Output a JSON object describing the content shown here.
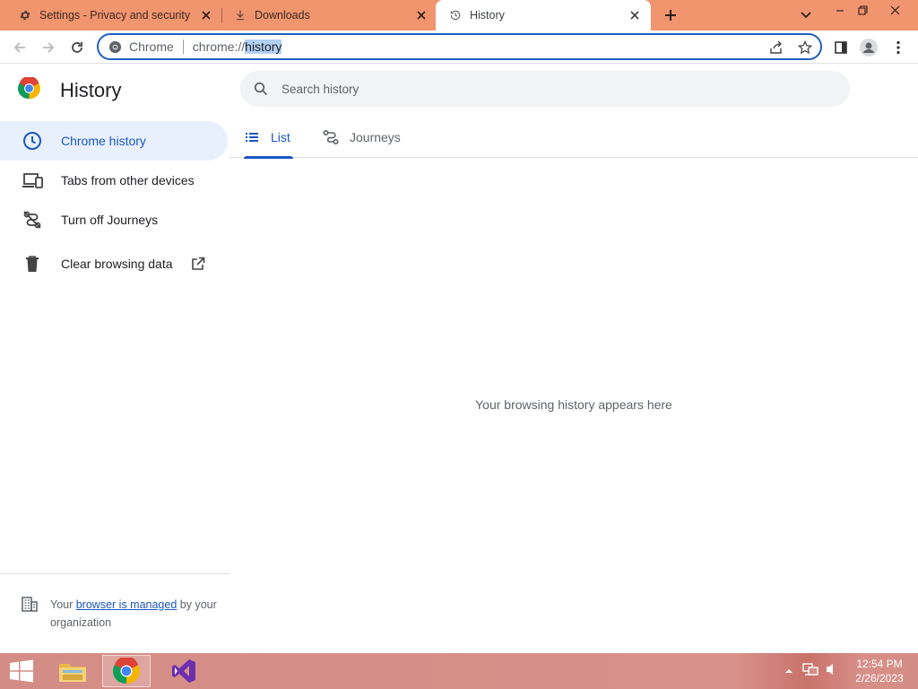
{
  "tabs": [
    {
      "label": "Settings - Privacy and security",
      "icon": "gear-icon"
    },
    {
      "label": "Downloads",
      "icon": "download-icon"
    },
    {
      "label": "History",
      "icon": "history-icon",
      "active": true
    }
  ],
  "omnibox": {
    "site_chip": "Chrome",
    "url_prefix": "chrome://",
    "url_selected": "history"
  },
  "page": {
    "title": "History",
    "search_placeholder": "Search history",
    "sidebar": [
      {
        "label": "Chrome history",
        "icon": "clock-icon",
        "selected": true
      },
      {
        "label": "Tabs from other devices",
        "icon": "devices-icon"
      },
      {
        "label": "Turn off Journeys",
        "icon": "journeys-off-icon"
      },
      {
        "label": "Clear browsing data",
        "icon": "trash-icon"
      }
    ],
    "managed": {
      "prefix": "Your ",
      "link": "browser is managed",
      "suffix": " by your organization"
    },
    "tabs": [
      {
        "label": "List",
        "icon": "list-icon",
        "active": true
      },
      {
        "label": "Journeys",
        "icon": "journeys-icon"
      }
    ],
    "empty_message": "Your browsing history appears here"
  },
  "taskbar": {
    "time": "12:54 PM",
    "date": "2/26/2023"
  },
  "colors": {
    "tabstrip": "#f1956f",
    "accent": "#1a57c1",
    "selected_bg": "#e8f0fe",
    "taskbar": "#d48d86"
  }
}
